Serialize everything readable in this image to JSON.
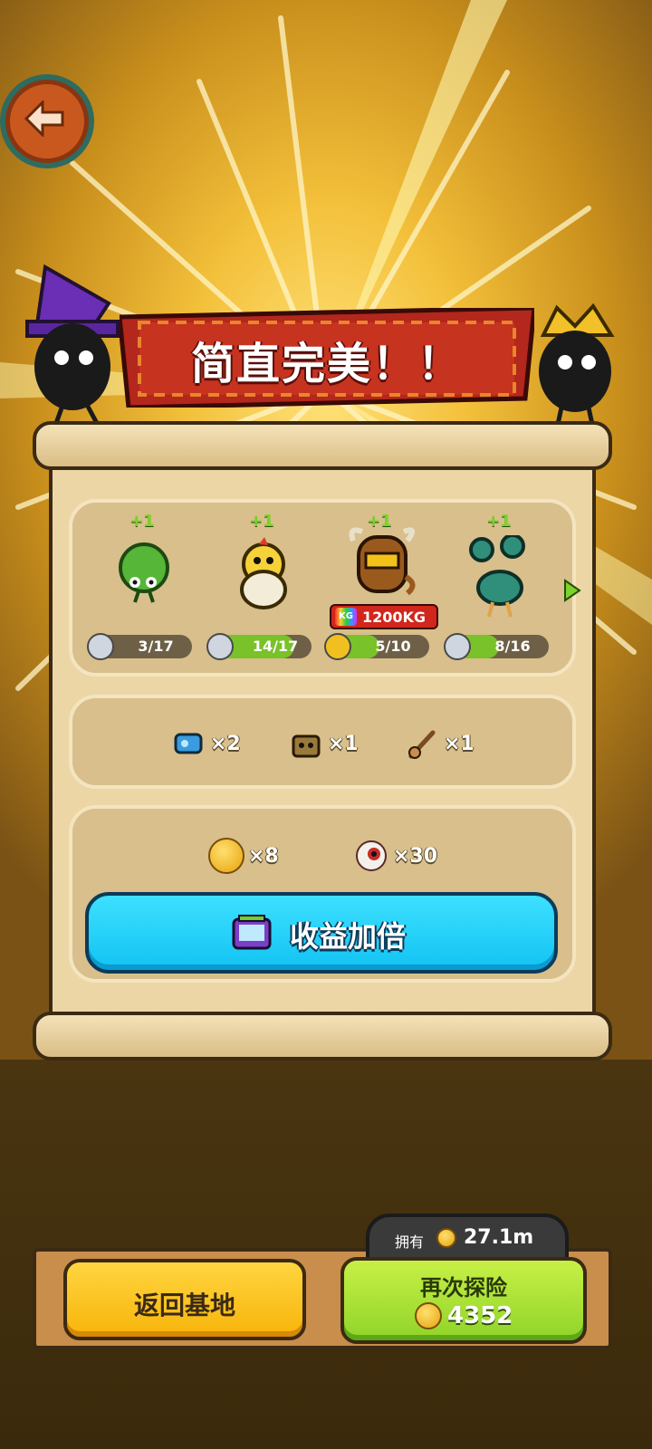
{
  "banner": {
    "title": "简直完美！！"
  },
  "monsters": [
    {
      "plus": "+1",
      "progress": "3/17",
      "fraction": 0.176
    },
    {
      "plus": "+1",
      "progress": "14/17",
      "fraction": 0.824
    },
    {
      "plus": "+1",
      "progress": "5/10",
      "fraction": 0.5,
      "weight": "1200KG",
      "weight_badge": "KG"
    },
    {
      "plus": "+1",
      "progress": "8/16",
      "fraction": 0.5
    }
  ],
  "items": [
    {
      "icon": "blue-machine-icon",
      "count": "×2"
    },
    {
      "icon": "treasure-box-icon",
      "count": "×1"
    },
    {
      "icon": "slingshot-icon",
      "count": "×1"
    }
  ],
  "rewards": [
    {
      "icon": "coin-icon",
      "count": "×8"
    },
    {
      "icon": "eyeball-icon",
      "count": "×30"
    }
  ],
  "double_button": {
    "label": "收益加倍"
  },
  "owned": {
    "label": "拥有",
    "amount": "27.1m"
  },
  "buttons": {
    "return_base": "返回基地",
    "explore_again": "再次探险",
    "explore_cost": "4352"
  },
  "colors": {
    "accent_blue": "#11c3f2",
    "accent_green": "#8fd42a",
    "accent_yellow": "#f7b40a",
    "banner_red": "#b3271c"
  }
}
